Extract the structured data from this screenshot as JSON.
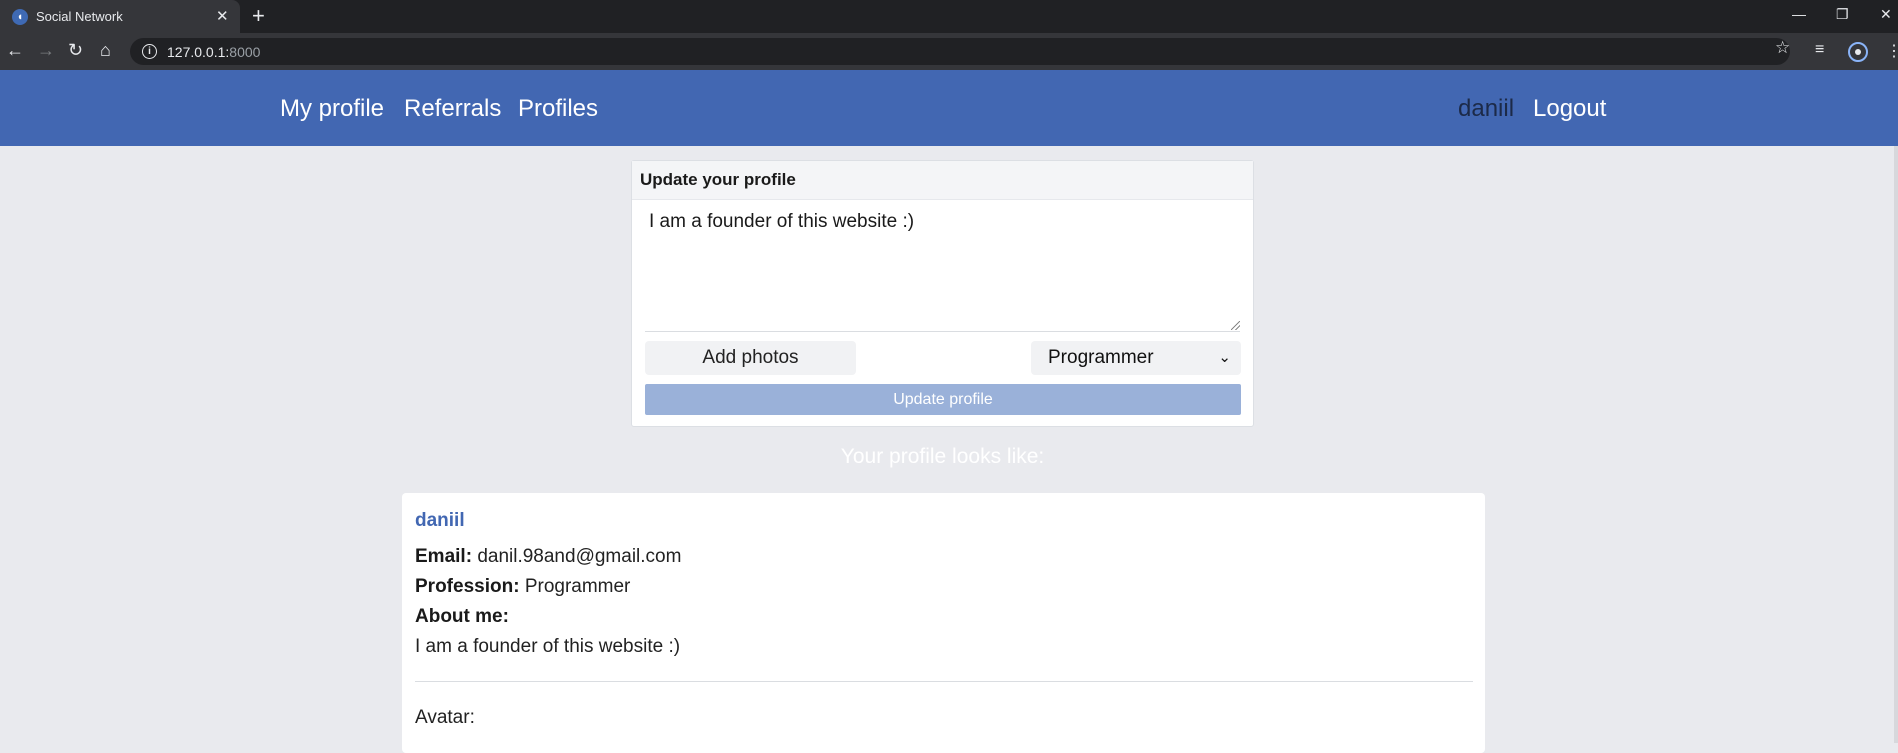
{
  "browser": {
    "tab_title": "Social Network",
    "tab_close": "✕",
    "new_tab": "+",
    "url_host": "127.0.0.1:",
    "url_port": "8000",
    "win_minimize": "—",
    "win_restore": "❐",
    "win_close": "✕"
  },
  "navbar": {
    "links": [
      "My profile",
      "Referrals",
      "Profiles"
    ],
    "username": "daniil",
    "logout": "Logout",
    "bg_color": "#4267b2"
  },
  "update_form": {
    "title": "Update your profile",
    "about_value": "I am a founder of this website :)",
    "add_photos_label": "Add photos",
    "profession_selected": "Programmer",
    "submit_label": "Update profile"
  },
  "preview": {
    "heading": "Your profile looks like:",
    "name": "daniil",
    "email_label": "Email:",
    "email_value": "danil.98and@gmail.com",
    "profession_label": "Profession:",
    "profession_value": "Programmer",
    "about_label": "About me:",
    "about_value": "I am a founder of this website :)",
    "avatar_label": "Avatar:"
  }
}
